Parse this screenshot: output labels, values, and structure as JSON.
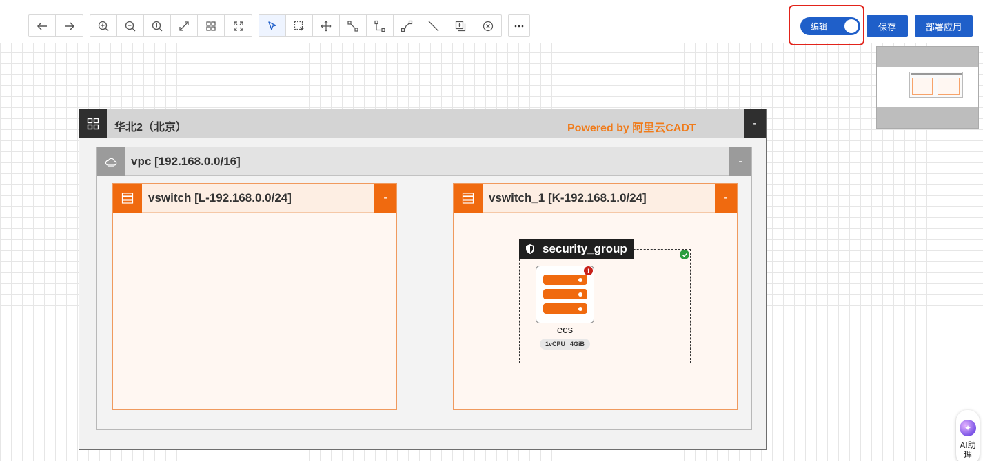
{
  "toolbar": {
    "groups": [
      {
        "tools": [
          "undo-icon",
          "redo-icon"
        ]
      },
      {
        "tools": [
          "zoom-in-icon",
          "zoom-out-icon",
          "actual-size-icon",
          "fit-icon",
          "grid-icon",
          "expand-icon"
        ]
      },
      {
        "tools": [
          "pointer-icon",
          "marquee-select-icon",
          "pan-icon",
          "connector-icon",
          "elbow-connector-icon",
          "curve-connector-icon",
          "line-icon",
          "copy-icon",
          "delete-icon"
        ],
        "active": "pointer-icon"
      },
      {
        "tools": [
          "more-icon"
        ]
      }
    ]
  },
  "header": {
    "edit_label": "编辑",
    "edit_on": true,
    "save_label": "保存",
    "deploy_label": "部署应用"
  },
  "region": {
    "title": "华北2（北京）",
    "powered_by": "Powered by 阿里云CADT",
    "collapse_label": "-"
  },
  "vpc": {
    "title": "vpc [192.168.0.0/16]",
    "collapse_label": "-"
  },
  "vswitches": [
    {
      "title": "vswitch [L-192.168.0.0/24]",
      "collapse_label": "-"
    },
    {
      "title": "vswitch_1 [K-192.168.1.0/24]",
      "collapse_label": "-"
    }
  ],
  "security_group": {
    "title": "security_group"
  },
  "ecs": {
    "name": "ecs",
    "alert": "!",
    "cpu": "1vCPU",
    "memory": "4GiB"
  },
  "ai_assistant": {
    "label": "AI助理"
  },
  "colors": {
    "accent": "#1f5fc9",
    "brand": "#f06a0f",
    "highlight": "#e2231a"
  }
}
